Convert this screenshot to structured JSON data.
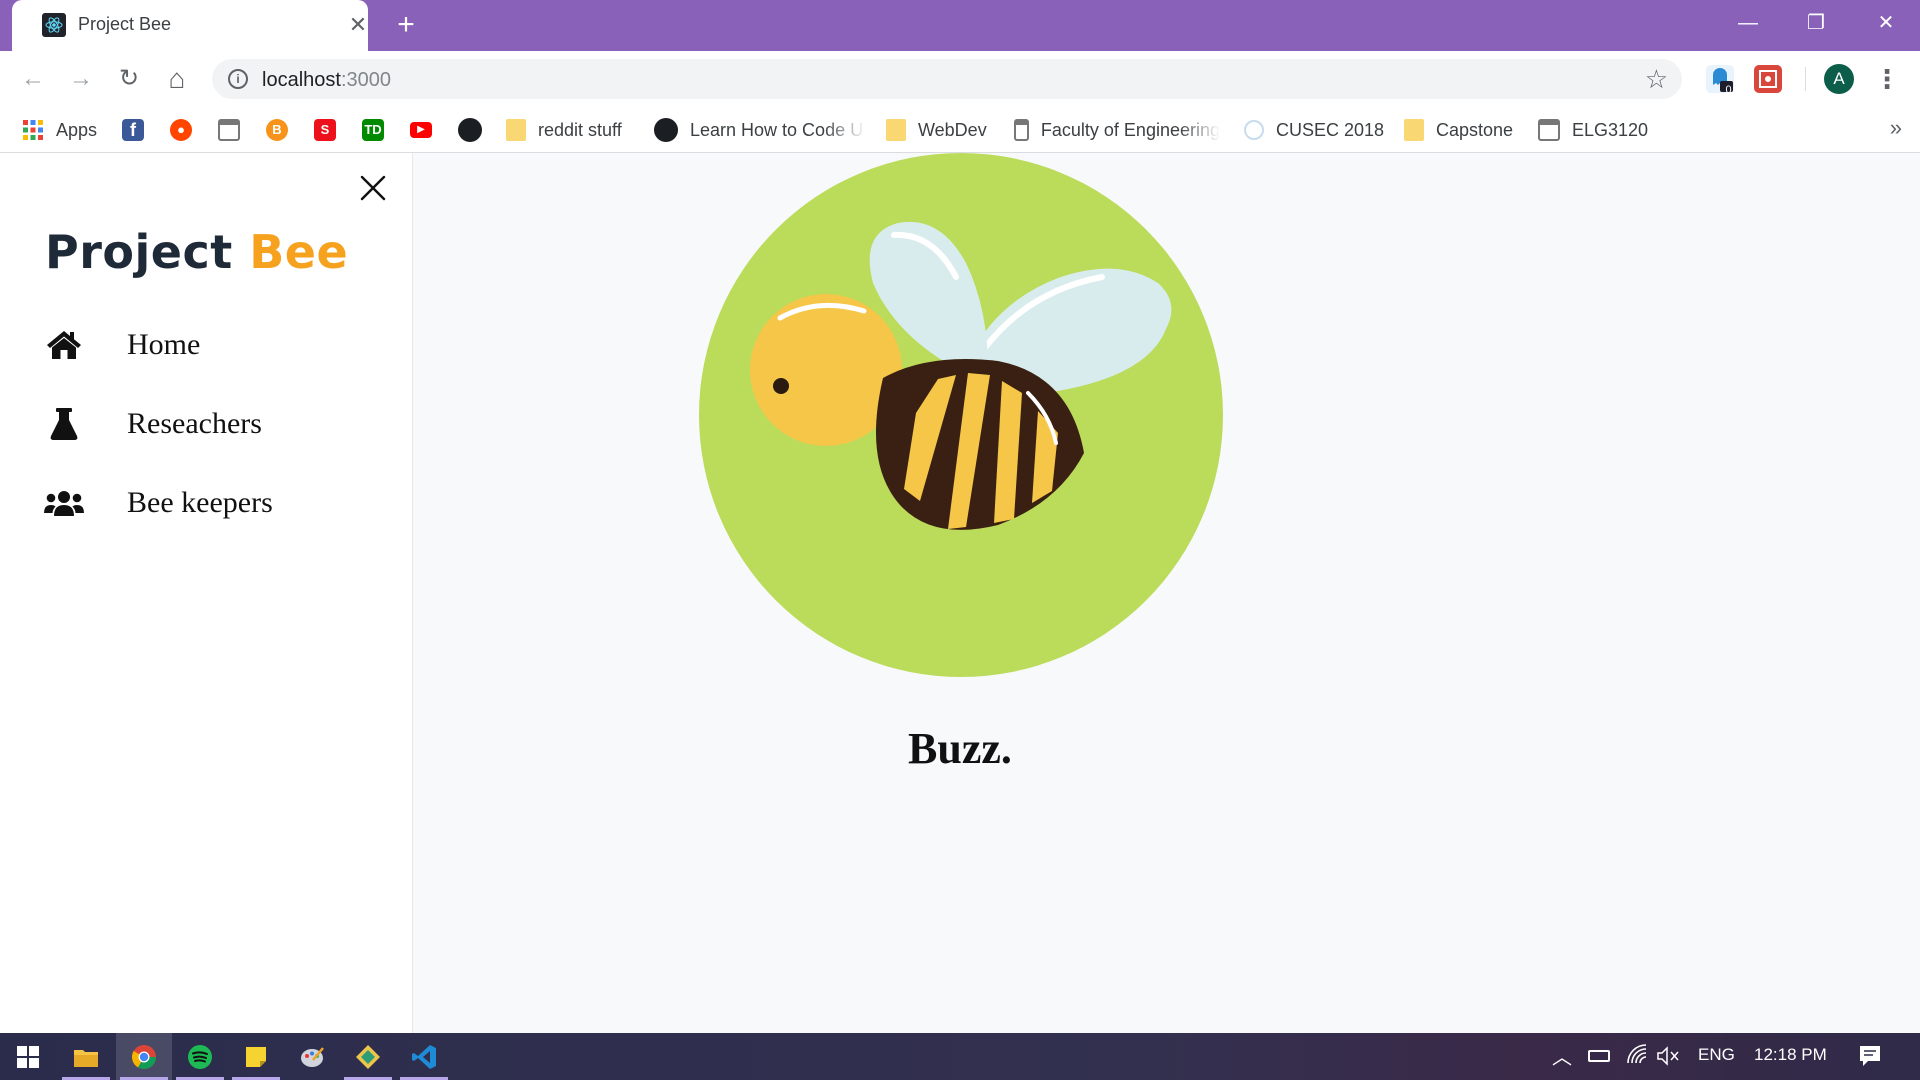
{
  "browser": {
    "tab": {
      "title": "Project Bee",
      "close_glyph": "✕",
      "favicon": "react-logo-icon"
    },
    "new_tab_glyph": "+",
    "window_controls": {
      "minimize": "—",
      "restore": "❐",
      "close": "✕"
    },
    "nav": {
      "back": "←",
      "forward": "→",
      "reload": "↻",
      "home": "⌂"
    },
    "address": {
      "host": "localhost",
      "port": ":3000",
      "info_glyph": "i",
      "star_glyph": "☆"
    },
    "extensions": {
      "badge_count": "0"
    },
    "profile_initial": "A",
    "menu_glyph": "⋮",
    "bookmarks": {
      "apps": "Apps",
      "items": [
        "reddit stuff",
        "Learn How to Code U",
        "WebDev",
        "Faculty of Engineering",
        "CUSEC 2018",
        "Capstone",
        "ELG3120"
      ],
      "more_glyph": "»"
    }
  },
  "sidebar": {
    "brand": {
      "word1": "Project",
      "word2": "Bee"
    },
    "close_glyph": "✕",
    "nav": [
      {
        "label": "Home",
        "icon": "home-icon"
      },
      {
        "label": "Reseachers",
        "icon": "flask-icon"
      },
      {
        "label": "Bee keepers",
        "icon": "users-icon"
      }
    ]
  },
  "main": {
    "tagline": "Buzz."
  },
  "taskbar": {
    "language": "ENG",
    "time": "12:18 PM"
  },
  "colors": {
    "tab_strip": "#8a61b9",
    "brand_dark": "#1f2a38",
    "brand_accent": "#f6a21e",
    "hero_circle": "#bbdb5a",
    "bee_yellow": "#f6c649",
    "bee_stripe": "#3a2012",
    "bee_wing": "#d8eced"
  }
}
